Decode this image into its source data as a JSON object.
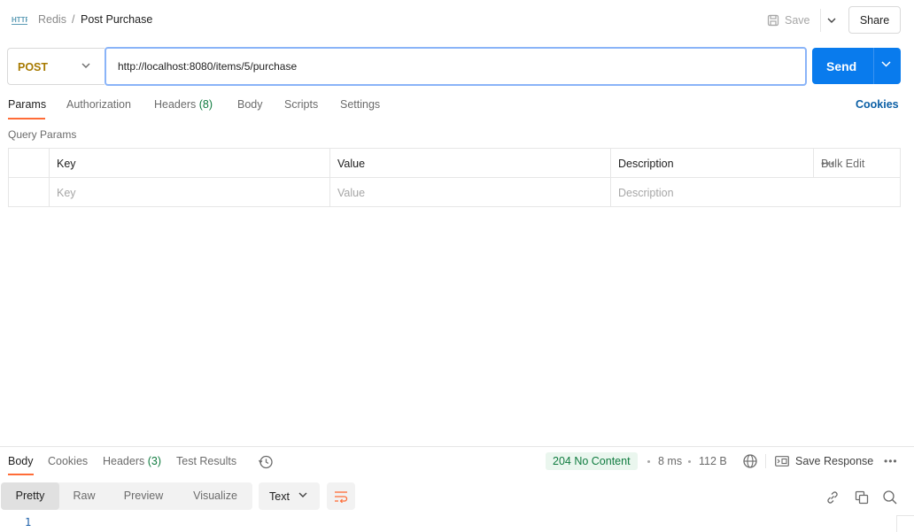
{
  "header": {
    "icon_label": "HTTP",
    "breadcrumb_parent": "Redis",
    "breadcrumb_sep": "/",
    "title": "Post Purchase",
    "save_label": "Save",
    "share_label": "Share"
  },
  "request": {
    "method": "POST",
    "url": "http://localhost:8080/items/5/purchase",
    "send_label": "Send"
  },
  "tabs": [
    {
      "label": "Params",
      "count": ""
    },
    {
      "label": "Authorization",
      "count": ""
    },
    {
      "label": "Headers",
      "count": "(8)"
    },
    {
      "label": "Body",
      "count": ""
    },
    {
      "label": "Scripts",
      "count": ""
    },
    {
      "label": "Settings",
      "count": ""
    }
  ],
  "cookies_label": "Cookies",
  "params": {
    "section_title": "Query Params",
    "headers": {
      "key": "Key",
      "value": "Value",
      "description": "Description"
    },
    "bulk_edit_label": "Bulk Edit",
    "placeholders": {
      "key": "Key",
      "value": "Value",
      "description": "Description"
    }
  },
  "response": {
    "tabs": [
      {
        "label": "Body",
        "count": ""
      },
      {
        "label": "Cookies",
        "count": ""
      },
      {
        "label": "Headers",
        "count": "(3)"
      },
      {
        "label": "Test Results",
        "count": ""
      }
    ],
    "status": "204 No Content",
    "time": "8 ms",
    "size": "112 B",
    "save_response_label": "Save Response",
    "formats": [
      "Pretty",
      "Raw",
      "Preview",
      "Visualize"
    ],
    "text_type": "Text",
    "line_number": "1"
  },
  "colors": {
    "accent": "#ff6c37",
    "send": "#097bed",
    "method_post": "#a77a00",
    "status_ok": "#0f7b3f",
    "link": "#0b5fa5"
  }
}
